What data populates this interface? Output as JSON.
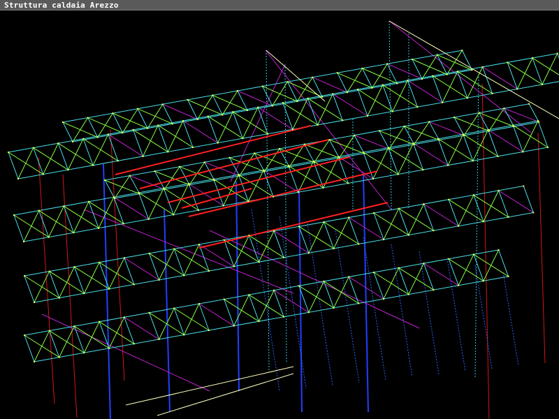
{
  "window": {
    "title": "Struttura caldaia Arezzo"
  },
  "viewport": {
    "background": "#000000",
    "description_free": true
  },
  "colors": {
    "beam_cyan": "#48e0e8",
    "brace_green": "#88ff40",
    "brace_magenta": "#c020d0",
    "column_red": "#d01818",
    "beam_red": "#ff2020",
    "column_blue": "#2040ff",
    "node_yellow": "#ffff40",
    "edge_white": "#ffffc0",
    "dotted_cyan": "#30c8e0",
    "dotted_blue": "#3060ff"
  },
  "icons": {
    "wireframe": "structure-wireframe"
  }
}
